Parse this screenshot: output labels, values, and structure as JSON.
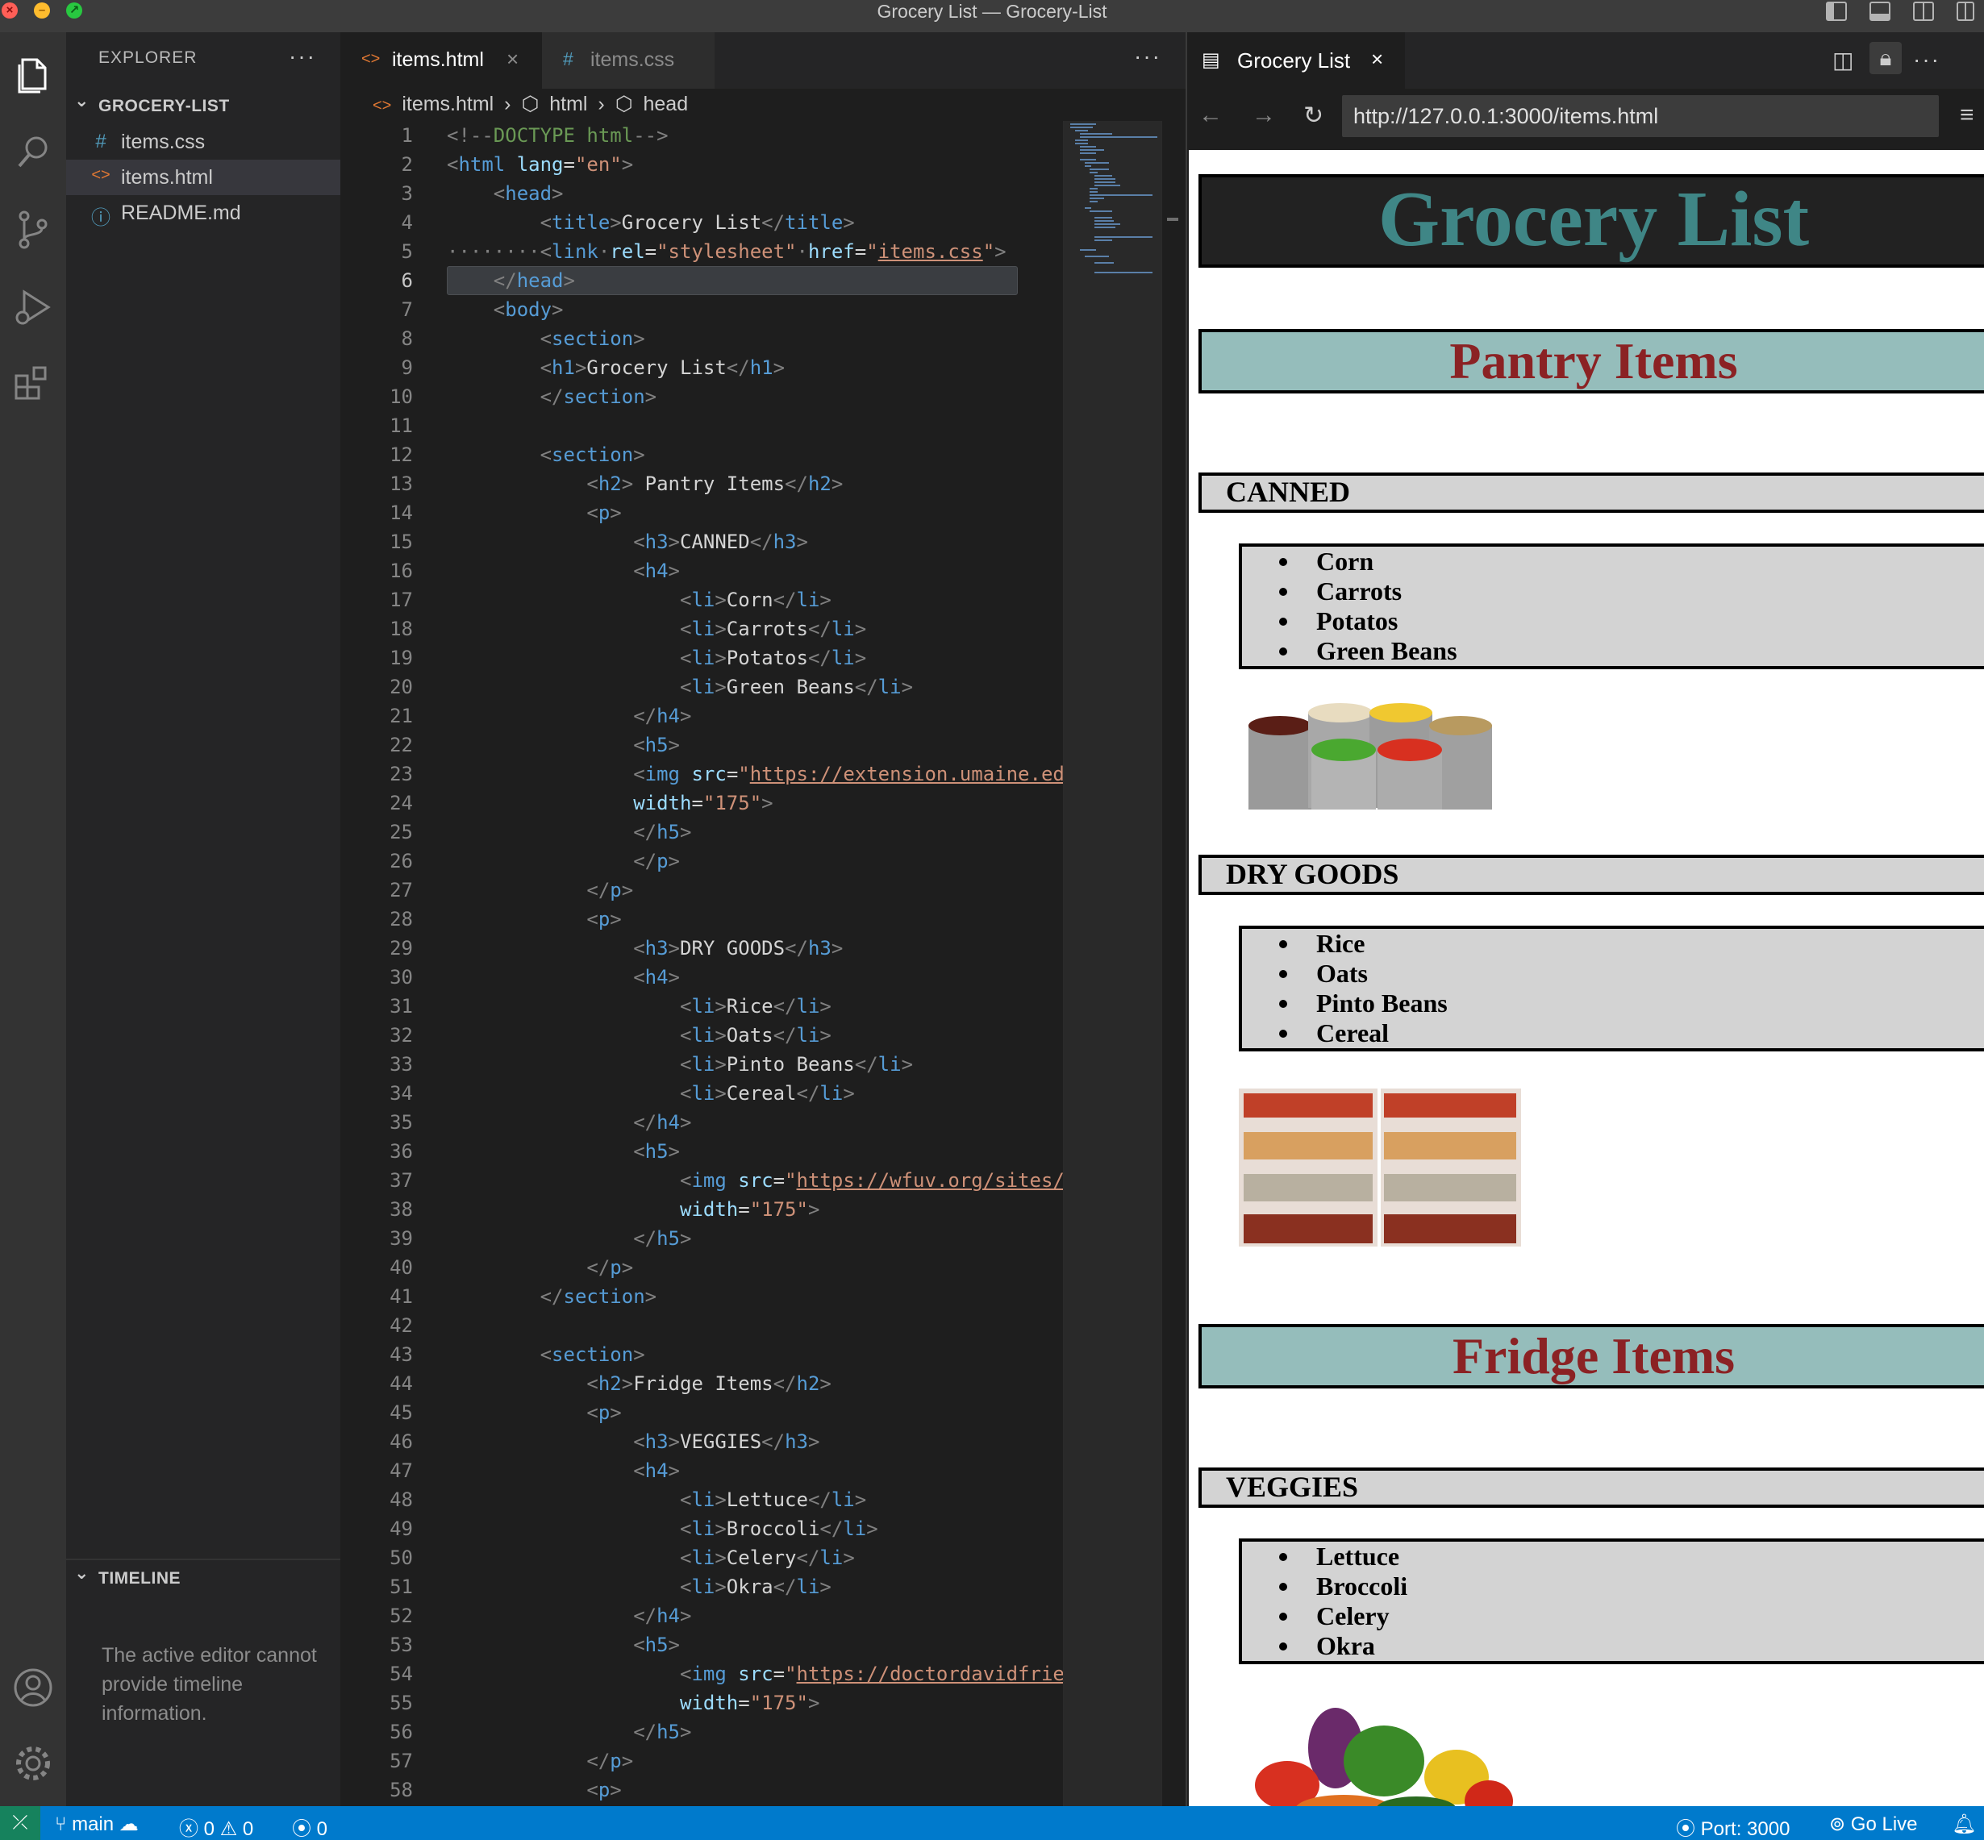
{
  "window": {
    "title": "Grocery List — Grocery-List"
  },
  "sidebar": {
    "header": "EXPLORER",
    "more": "···",
    "folder": "GROCERY-LIST",
    "files": [
      {
        "name": "items.css",
        "icon": "#",
        "color": "#519aba",
        "active": false
      },
      {
        "name": "items.html",
        "icon": "<>",
        "color": "#e37933",
        "active": true
      },
      {
        "name": "README.md",
        "icon": "ⓘ",
        "color": "#519aba",
        "active": false
      }
    ],
    "timeline_title": "TIMELINE",
    "timeline_message": "The active editor cannot provide timeline information."
  },
  "editor": {
    "tabs": [
      {
        "name": "items.html",
        "icon": "<>",
        "close": "×"
      },
      {
        "name": "items.css",
        "icon": "#"
      }
    ],
    "more": "···",
    "breadcrumb": {
      "file": "items.html",
      "sep": "›",
      "node1": "html",
      "node2": "head"
    },
    "current_line": 6,
    "line_numbers": [
      "1",
      "2",
      "3",
      "4",
      "5",
      "6",
      "7",
      "8",
      "9",
      "10",
      "11",
      "12",
      "13",
      "14",
      "15",
      "16",
      "17",
      "18",
      "19",
      "20",
      "21",
      "22",
      "23",
      "24",
      "25",
      "26",
      "27",
      "28",
      "29",
      "30",
      "31",
      "32",
      "33",
      "34",
      "35",
      "36",
      "37",
      "38",
      "39",
      "40",
      "41",
      "42",
      "43",
      "44",
      "45",
      "46",
      "47",
      "48",
      "49",
      "50",
      "51",
      "52",
      "53",
      "54",
      "55",
      "56",
      "57",
      "58"
    ]
  },
  "preview": {
    "tab_title": "Grocery List",
    "tab_close": "×",
    "url": "http://127.0.0.1:3000/items.html",
    "page": {
      "h1": "Grocery List",
      "sections": [
        {
          "h2": "Pantry Items"
        },
        {
          "h2": "Fridge Items"
        }
      ],
      "groups": [
        {
          "h3": "CANNED",
          "items": [
            "Corn",
            "Carrots",
            "Potatos",
            "Green Beans"
          ]
        },
        {
          "h3": "DRY GOODS",
          "items": [
            "Rice",
            "Oats",
            "Pinto Beans",
            "Cereal"
          ]
        },
        {
          "h3": "VEGGIES",
          "items": [
            "Lettuce",
            "Broccoli",
            "Celery",
            "Okra"
          ]
        }
      ]
    }
  },
  "status": {
    "branch": "main",
    "errors": "0",
    "warnings": "0",
    "ports_count": "0",
    "port": "Port: 3000",
    "go_live": "Go Live"
  }
}
